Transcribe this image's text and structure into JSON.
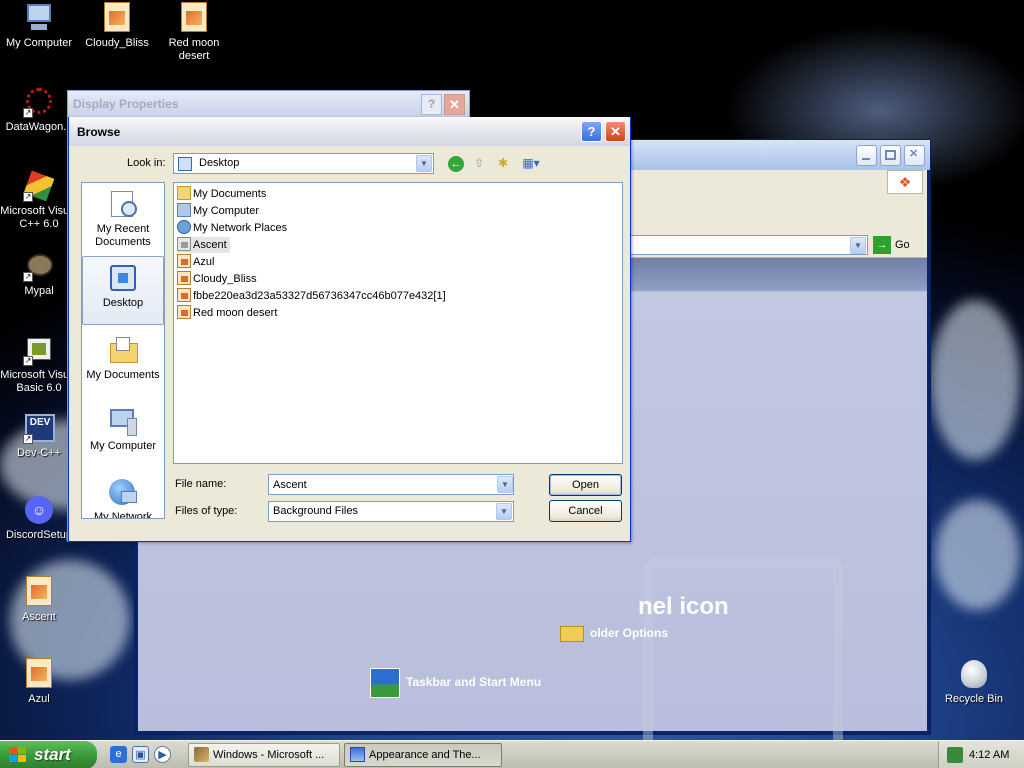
{
  "desktop": {
    "icons": [
      {
        "label": "My Computer",
        "icon": "my-computer-icon"
      },
      {
        "label": "Cloudy_Bliss",
        "icon": "image-file-icon"
      },
      {
        "label": "Red moon desert",
        "icon": "image-file-icon"
      },
      {
        "label": "DataWagon...",
        "icon": "datawagon-shortcut-icon"
      },
      {
        "label": "Microsoft Visual C++ 6.0",
        "icon": "visual-cpp-shortcut-icon"
      },
      {
        "label": "Mypal",
        "icon": "mypal-shortcut-icon"
      },
      {
        "label": "Microsoft Visual Basic 6.0",
        "icon": "visual-basic-shortcut-icon"
      },
      {
        "label": "Dev-C++",
        "icon": "dev-cpp-shortcut-icon"
      },
      {
        "label": "DiscordSetup",
        "icon": "discord-icon"
      },
      {
        "label": "Ascent",
        "icon": "image-file-icon"
      },
      {
        "label": "Azul",
        "icon": "image-file-icon"
      },
      {
        "label": "Recycle Bin",
        "icon": "recycle-bin-icon"
      }
    ]
  },
  "control_panel_window": {
    "go_label": "Go",
    "heading_fragment": "nel icon",
    "tasks": [
      {
        "label": "older Options",
        "icon": "folder-options-icon"
      },
      {
        "label": "Taskbar and Start Menu",
        "icon": "taskbar-start-menu-icon"
      }
    ]
  },
  "display_properties": {
    "title": "Display Properties",
    "help_glyph": "?",
    "close_glyph": "✕"
  },
  "browse_dialog": {
    "title": "Browse",
    "help_glyph": "?",
    "close_glyph": "✕",
    "lookin_label": "Look in:",
    "lookin_value": "Desktop",
    "places": [
      {
        "label": "My Recent Documents",
        "icon": "recent-documents-icon",
        "selected": false
      },
      {
        "label": "Desktop",
        "icon": "desktop-icon",
        "selected": true
      },
      {
        "label": "My Documents",
        "icon": "my-documents-icon",
        "selected": false
      },
      {
        "label": "My Computer",
        "icon": "my-computer-icon",
        "selected": false
      },
      {
        "label": "My Network",
        "icon": "my-network-icon",
        "selected": false
      }
    ],
    "files": [
      {
        "name": "My Documents",
        "icon": "folder"
      },
      {
        "name": "My Computer",
        "icon": "computer"
      },
      {
        "name": "My Network Places",
        "icon": "network"
      },
      {
        "name": "Ascent",
        "icon": "image-gray",
        "selected": true
      },
      {
        "name": "Azul",
        "icon": "image"
      },
      {
        "name": "Cloudy_Bliss",
        "icon": "image"
      },
      {
        "name": "fbbe220ea3d23a53327d56736347cc46b077e432[1]",
        "icon": "image"
      },
      {
        "name": "Red moon desert",
        "icon": "image"
      }
    ],
    "filename_label": "File name:",
    "filename_value": "Ascent",
    "filetype_label": "Files of type:",
    "filetype_value": "Background Files",
    "open_label": "Open",
    "cancel_label": "Cancel"
  },
  "taskbar": {
    "start_label": "start",
    "tasks": [
      {
        "label": "Windows - Microsoft ...",
        "active": false
      },
      {
        "label": "Appearance and The...",
        "active": true
      }
    ],
    "clock": "4:12 AM"
  }
}
